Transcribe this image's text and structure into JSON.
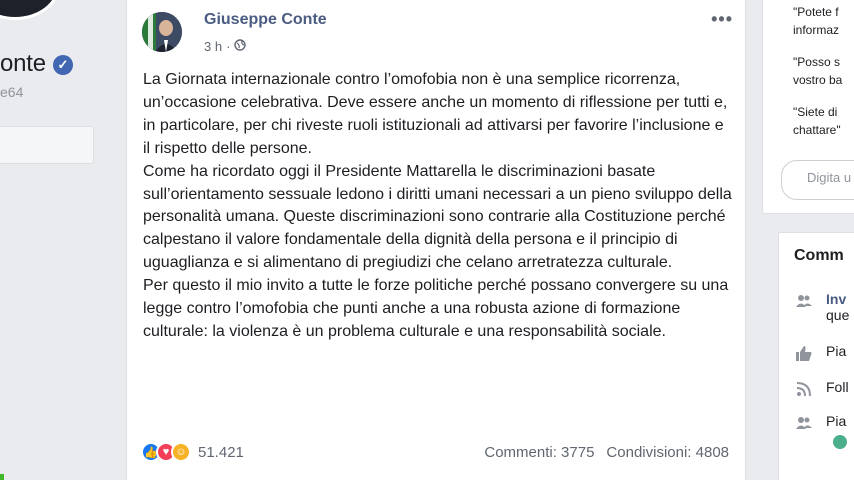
{
  "profile": {
    "name_fragment": "onte",
    "handle_fragment": "e64"
  },
  "post": {
    "author": "Giuseppe Conte",
    "time": "3 h",
    "paragraphs": [
      "La Giornata internazionale contro l’omofobia non è una semplice ricorrenza, un’occasione celebrativa. Deve essere anche un momento di riflessione per tutti e, in particolare, per chi riveste ruoli istituzionali ad attivarsi per favorire l’inclusione e il rispetto delle persone.",
      "Come ha ricordato oggi il Presidente Mattarella le discriminazioni basate sull’orientamento sessuale ledono i diritti umani necessari a un pieno sviluppo della personalità umana. Queste discriminazioni sono contrarie alla Costituzione perché calpestano il valore fondamentale della dignità della persona e il principio di uguaglianza e si alimentano di pregiudizi che celano arretratezza culturale.",
      "Per questo il mio invito a tutte le forze politiche perché possano convergere su una legge contro l’omofobia che punti anche a una robusta azione di formazione culturale: la violenza è un problema culturale e una responsabilità sociale."
    ],
    "reactions_count": "51.421",
    "comments": "Commenti: 3775",
    "shares": "Condivisioni: 4808"
  },
  "messenger": {
    "suggestions": [
      [
        "\"Potete f",
        "informaz"
      ],
      [
        "\"Posso s",
        "vostro ba"
      ],
      [
        "\"Siete di",
        "chattare\""
      ]
    ],
    "input_placeholder": "Digita u"
  },
  "community": {
    "title": "Comm",
    "rows": [
      {
        "icon": "people-icon",
        "text": "Inv",
        "text2": "que"
      },
      {
        "icon": "thumbs-up-icon",
        "text": "Pia"
      },
      {
        "icon": "rss-icon",
        "text": "Foll"
      },
      {
        "icon": "people-icon",
        "text": "Pia"
      }
    ]
  },
  "colors": {
    "author_link": "#4b5c82",
    "like": "#1877f2",
    "love": "#f33e58",
    "care": "#f7b125",
    "background": "#e9ebee"
  }
}
